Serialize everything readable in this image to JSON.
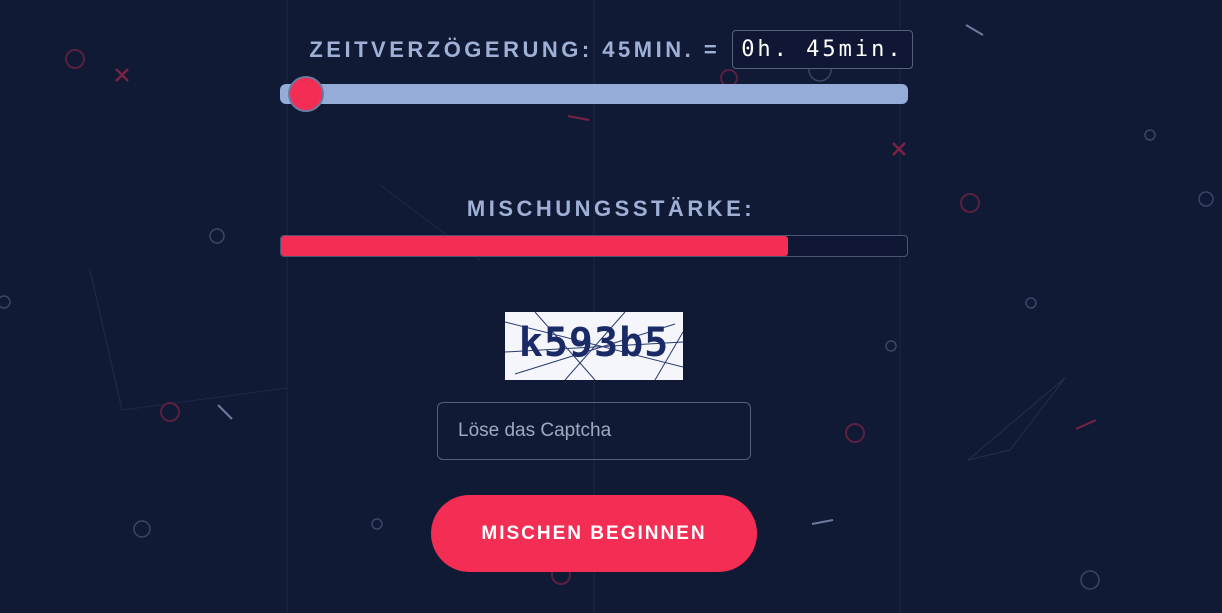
{
  "delay": {
    "label": "ZEITVERZÖGERUNG: 45MIN. =",
    "value": "0h. 45min.",
    "slider_fraction": 0.04
  },
  "strength": {
    "label": "MISCHUNGSSTÄRKE:",
    "percent": 81
  },
  "captcha": {
    "code": "k593b5",
    "input_placeholder": "Löse das Captcha",
    "input_value": ""
  },
  "start_button": {
    "label": "MISCHEN BEGINNEN"
  },
  "colors": {
    "background": "#111a35",
    "accent": "#f42d55",
    "label": "#9fb0d6",
    "track": "#95acd9"
  }
}
